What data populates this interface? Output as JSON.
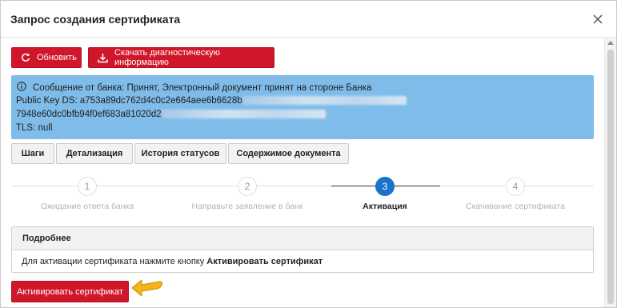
{
  "dialog": {
    "title": "Запрос создания сертификата",
    "close_icon": "close-icon"
  },
  "toolbar": {
    "refresh_label": "Обновить",
    "refresh_icon": "refresh-icon",
    "download_label": "Скачать диагностическую информацию",
    "download_icon": "download-icon"
  },
  "alert": {
    "icon": "info-icon",
    "message": "Сообщение от банка: Принят, Электронный документ принят на стороне Банка",
    "public_key_prefix": "Public Key DS: a753a89dc762d4c0c2e664aee6b6628b",
    "key_line_2_prefix": "7948e60dc0bfb94f0ef683a81020d2",
    "tls": "TLS: null",
    "background": "#7fbce9"
  },
  "tabs": [
    {
      "label": "Шаги"
    },
    {
      "label": "Детализация"
    },
    {
      "label": "История статусов"
    },
    {
      "label": "Содержимое документа"
    }
  ],
  "steps": [
    {
      "number": "1",
      "label": "Ожидание ответа банка",
      "active": false
    },
    {
      "number": "2",
      "label": "Направьте заявление в банк",
      "active": false
    },
    {
      "number": "3",
      "label": "Активация",
      "active": true
    },
    {
      "number": "4",
      "label": "Скачивание сертификата",
      "active": false
    }
  ],
  "details": {
    "heading": "Подробнее",
    "text_prefix": "Для активации сертификата нажмите кнопку",
    "text_bold": "Активировать сертификат"
  },
  "actions": {
    "activate_label": "Активировать сертификат",
    "pointer_icon": "arrow-pointer-icon"
  },
  "colors": {
    "accent_red": "#d0172a",
    "step_active": "#1a73c8",
    "pointer_yellow": "#f3b31b"
  }
}
